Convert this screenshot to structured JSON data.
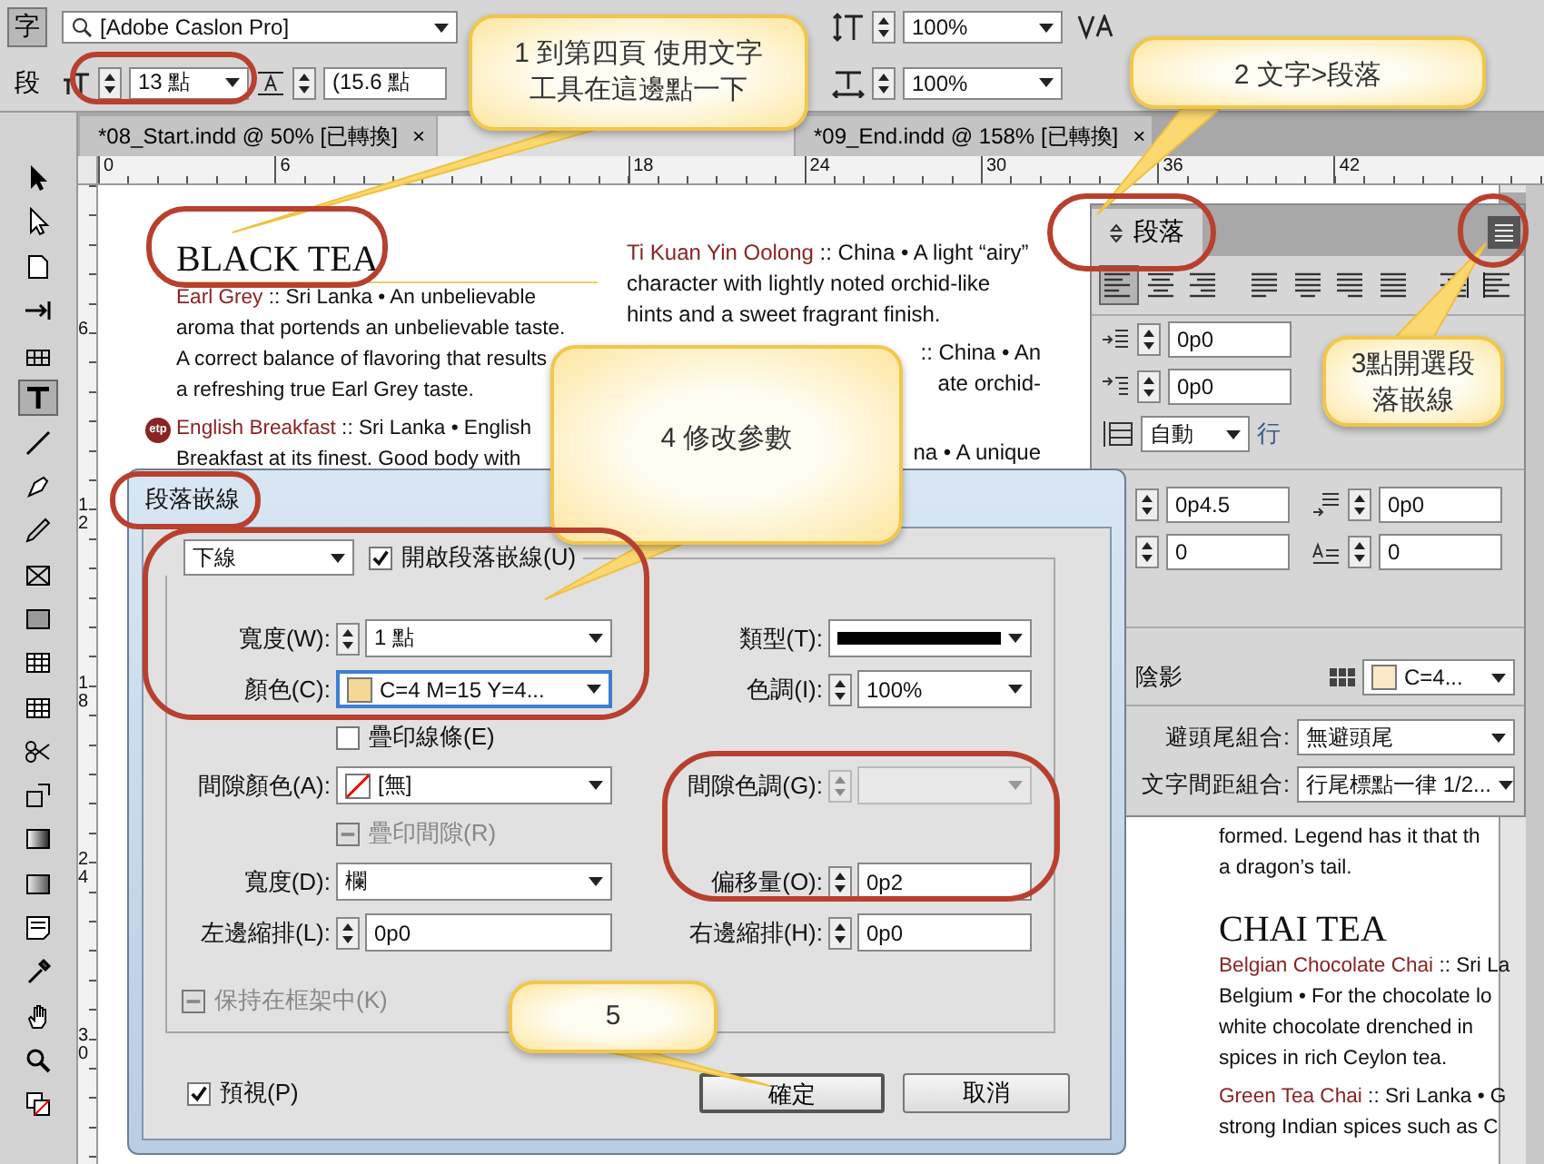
{
  "control_bar": {
    "mode_buttons": [
      {
        "label": "字",
        "selected": true
      },
      {
        "label": "段",
        "selected": false
      }
    ],
    "font_field": {
      "value": "[Adobe Caslon Pro]"
    },
    "size_field": {
      "value": "13 點"
    },
    "leading_field": {
      "value": "(15.6 點"
    },
    "vertical_scale": {
      "value": "100%"
    },
    "horizontal_scale": {
      "value": "100%"
    }
  },
  "tabs": [
    {
      "label": "*08_Start.indd @ 50% [已轉換]",
      "close": "×",
      "selected": false
    },
    {
      "selected": true
    },
    {
      "label": "*09_End.indd @ 158% [已轉換]",
      "close": "×",
      "selected": false
    }
  ],
  "horizontal_ruler": [
    "0",
    "6",
    "18",
    "24",
    "30",
    "36",
    "42"
  ],
  "vertical_ruler": [
    "6",
    "12",
    "18",
    "24",
    "30"
  ],
  "tools": [
    {
      "kind": "arrow",
      "selected": false
    },
    {
      "kind": "hollow-arrow",
      "selected": false
    },
    {
      "kind": "page",
      "selected": false
    },
    {
      "kind": "gap",
      "selected": false
    },
    {
      "kind": "grid",
      "selected": false
    },
    {
      "kind": "type",
      "selected": true
    },
    {
      "kind": "line",
      "selected": false
    },
    {
      "kind": "pen",
      "selected": false
    },
    {
      "kind": "pencil",
      "selected": false
    },
    {
      "kind": "crossed-frame",
      "selected": false
    },
    {
      "kind": "rectangle",
      "selected": false
    },
    {
      "kind": "table",
      "selected": false
    },
    {
      "kind": "table",
      "selected": false
    },
    {
      "kind": "scissors",
      "selected": false
    },
    {
      "kind": "transform",
      "selected": false
    },
    {
      "kind": "gradient",
      "selected": false
    },
    {
      "kind": "feather",
      "selected": false
    },
    {
      "kind": "note",
      "selected": false
    },
    {
      "kind": "eyedropper",
      "selected": false
    },
    {
      "kind": "hand",
      "selected": false
    },
    {
      "kind": "zoom",
      "selected": false
    },
    {
      "kind": "fill-stroke",
      "selected": false
    }
  ],
  "document": {
    "heading": "BLACK TEA",
    "left_column": [
      {
        "kind": "line",
        "name": "Earl Grey",
        "text": " :: Sri Lanka • An unbelievable"
      },
      {
        "kind": "line",
        "text": "aroma that portends an unbelievable taste."
      },
      {
        "kind": "line",
        "text": "A correct balance of flavoring that results"
      },
      {
        "kind": "line",
        "text": "a refreshing true Earl Grey taste."
      },
      {
        "kind": "para",
        "badge": "etp",
        "name": "English Breakfast",
        "text": " :: Sri Lanka • English"
      },
      {
        "kind": "line",
        "text": "Breakfast at its finest. Good body with"
      }
    ],
    "right_column": [
      {
        "kind": "line",
        "name": "Ti Kuan Yin Oolong",
        "text": " :: China • A light “airy”"
      },
      {
        "kind": "line",
        "text": "character with lightly noted orchid-like"
      },
      {
        "kind": "line",
        "text": "hints and a sweet fragrant finish."
      },
      {
        "kind": "cut-para",
        "text": ":: China • An"
      },
      {
        "kind": "cut-line",
        "text": "ate orchid-"
      },
      {
        "kind": "cut-covered-para",
        "text": "na • A unique"
      }
    ],
    "lower_column": [
      {
        "kind": "line",
        "text": "formed. Legend has it that th"
      },
      {
        "kind": "line",
        "text": "a dragon’s tail."
      },
      {
        "kind": "heading",
        "text": "CHAI TEA"
      },
      {
        "kind": "line",
        "name": "Belgian Chocolate Chai",
        "text": " :: Sri La"
      },
      {
        "kind": "line",
        "text": "Belgium • For the chocolate lo"
      },
      {
        "kind": "line",
        "text": "white chocolate drenched in"
      },
      {
        "kind": "line",
        "text": "spices in rich Ceylon tea."
      },
      {
        "kind": "para",
        "name": "Green Tea Chai",
        "text": " :: Sri Lanka • G"
      },
      {
        "kind": "line",
        "text": "strong Indian spices such as C"
      }
    ]
  },
  "paragraph_panel": {
    "title": "段落",
    "align_buttons": [
      {
        "kind": "left",
        "selected": true
      },
      {
        "kind": "center",
        "selected": false
      },
      {
        "kind": "right",
        "selected": false
      },
      {
        "kind": "justify-left",
        "selected": false
      },
      {
        "kind": "justify-center",
        "selected": false
      },
      {
        "kind": "justify-right",
        "selected": false
      },
      {
        "kind": "justify-all",
        "selected": false
      },
      {
        "kind": "towards-spine",
        "selected": false
      },
      {
        "kind": "away-spine",
        "selected": false
      }
    ],
    "indent_fields": [
      {
        "kind": "left-indent",
        "value": "0p0"
      },
      {
        "kind": "first-line",
        "value": "0p0"
      }
    ],
    "grid_select": {
      "value": "自動",
      "unit": "行"
    },
    "space_fields": [
      {
        "value": "0p4.5"
      },
      {
        "value": "0p0"
      },
      {
        "value": "0"
      },
      {
        "value": "0"
      }
    ],
    "shading": {
      "label": "陰影",
      "value": "C=4..."
    },
    "kinsoku": {
      "label": "避頭尾組合:",
      "value": "無避頭尾"
    },
    "mojikumi": {
      "label": "文字間距組合:",
      "value": "行尾標點一律 1/2..."
    }
  },
  "dialog": {
    "title": "段落嵌線",
    "rule_select": "下線",
    "enable": {
      "label": "開啟段落嵌線(U)",
      "checked": true
    },
    "rows": [
      {
        "left": {
          "label": "寬度(W):",
          "kind": "spin-combo",
          "value": "1 點"
        },
        "right": {
          "label": "類型(T):",
          "kind": "stroke-combo"
        }
      },
      {
        "left": {
          "label": "顏色(C):",
          "kind": "swatch-combo",
          "value": "C=4 M=15 Y=4...",
          "focused": true
        },
        "right": {
          "label": "色調(I):",
          "kind": "spin-combo",
          "value": "100%"
        }
      },
      {
        "check": {
          "label": "疊印線條(E)",
          "checked": false,
          "disabled": false
        }
      },
      {
        "left": {
          "label": "間隙顏色(A):",
          "kind": "none-combo",
          "value": "[無]"
        },
        "right": {
          "label": "間隙色調(G):",
          "kind": "spin-combo",
          "disabled": true
        }
      },
      {
        "check": {
          "label": "疊印間隙(R)",
          "checked": false,
          "disabled": true
        }
      },
      {
        "left": {
          "label": "寬度(D):",
          "kind": "combo",
          "value": "欄"
        },
        "right": {
          "label": "偏移量(O):",
          "kind": "spin-field",
          "value": "0p2"
        }
      },
      {
        "left": {
          "label": "左邊縮排(L):",
          "kind": "spin-field",
          "value": "0p0"
        },
        "right": {
          "label": "右邊縮排(H):",
          "kind": "spin-field",
          "value": "0p0"
        }
      }
    ],
    "keep_in_frame": {
      "label": "保持在框架中(K)",
      "checked": false,
      "disabled": true
    },
    "preview": {
      "label": "預視(P)",
      "checked": true
    },
    "buttons": [
      {
        "label": "確定",
        "default": true
      },
      {
        "label": "取消",
        "default": false
      }
    ]
  },
  "callouts": [
    {
      "text": "1 到第四頁 使用文字工具在這邊點一下"
    },
    {
      "text": "2 文字>段落"
    },
    {
      "text": "3點開選段落嵌線"
    },
    {
      "text": "4 修改參數"
    },
    {
      "text": "5"
    }
  ]
}
